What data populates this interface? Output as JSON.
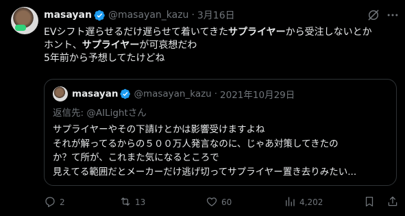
{
  "tweet": {
    "author_name": "masayan",
    "author_handle": "@masayan_kazu",
    "separator": "·",
    "date": "3月16日",
    "body_lines": [
      [
        {
          "t": "EVシフト遅らせるだけ遅らせて着いてきた"
        },
        {
          "t": "サプライヤー",
          "b": true
        },
        {
          "t": "から受注しないとか"
        }
      ],
      [
        {
          "t": "ホント、"
        },
        {
          "t": "サプライヤー",
          "b": true
        },
        {
          "t": "が可哀想だわ"
        }
      ],
      [
        {
          "t": "5年前から予想してたけどね"
        }
      ]
    ]
  },
  "quote": {
    "author_name": "masayan",
    "author_handle": "@masayan_kazu",
    "separator": "·",
    "date": "2021年10月29日",
    "reply_prefix": "返信先: ",
    "reply_mention": "@AILightさん",
    "lines": [
      "サプライヤーやその下請けとかは影響受けますよね",
      "それが解ってるからの５００万人発言なのに、じゃあ対策してきたの",
      "か？て所が、これまた気になるところで",
      "見えてる範囲だとメーカーだけ逃げ切ってサプライヤー置き去りみたい..."
    ]
  },
  "actions": {
    "replies": "2",
    "reposts": "13",
    "likes": "60",
    "views": "4,202"
  },
  "icons": [
    "verified-icon",
    "grok-icon",
    "more-icon",
    "reply-icon",
    "repost-icon",
    "like-icon",
    "views-icon",
    "bookmark-icon",
    "share-icon"
  ],
  "colors": {
    "background": "#000000",
    "text": "#e7e9ea",
    "muted": "#71767b",
    "verified": "#1d9bf0",
    "border": "#2f3336"
  }
}
